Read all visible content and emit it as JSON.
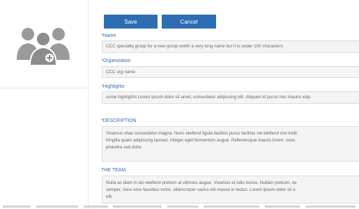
{
  "actions": {
    "save_label": "Save",
    "cancel_label": "Cancel"
  },
  "fields": {
    "name": {
      "required_mark": "*",
      "label": "Name",
      "value": "CCC specialty group for a new group wwith a very long name but it is under 100 characters"
    },
    "organization": {
      "required_mark": "*",
      "label": "Organization",
      "value": "CCC org name"
    },
    "highlights": {
      "required_mark": "*",
      "label": "Highlights",
      "value": "some highlights Lorem ipsum dolor sit amet, consectetur adipiscing elit. Aliquam id purus nec mauris vulp"
    },
    "description": {
      "required_mark": "*",
      "label": "DESCRIPTION",
      "value": "Vivamus vitae consectetur magna. Nunc eleifend ligula facilisis purus facilisis vel eleifend nisl molli\nfringilla quam adipiscing laoreet. Integer eget fermentum augue. Pellentesque mauris lorem, cons\npharetra sed dolor."
    },
    "team": {
      "label": "THE TEAM",
      "value": "Nulla ac diam in dui eleifend pretium at ultricies augue. Vivamus et odio lectus. Nullam pretium, ne\nsemper, risus eros faucibus tortor, ullamcorper varius elit massa in lectus. Lorem ipsum dolor sit a\nelit."
    }
  },
  "icons": {
    "avatar": "group-add-icon"
  },
  "colors": {
    "accent": "#2e6db3",
    "required": "#d9534f",
    "field_bg": "#f4f4f4"
  }
}
